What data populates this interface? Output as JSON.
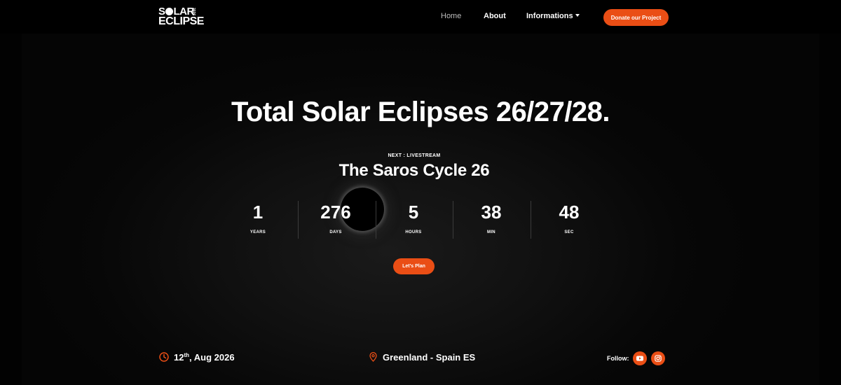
{
  "header": {
    "logo_line1_a": "S",
    "logo_line1_b": "LAR",
    "logo_tiny": "2026",
    "logo_line2": "ECLIPSE",
    "nav": {
      "home": "Home",
      "about": "About",
      "informations": "Informations"
    },
    "donate_label": "Donate our Project"
  },
  "hero": {
    "title": "Total Solar Eclipses 26/27/28.",
    "next_label": "NEXT : LIVESTREAM",
    "subtitle": "The Saros Cycle 26",
    "countdown": [
      {
        "value": "1",
        "unit": "YEARS"
      },
      {
        "value": "276",
        "unit": "DAYS"
      },
      {
        "value": "5",
        "unit": "HOURS"
      },
      {
        "value": "38",
        "unit": "MIN"
      },
      {
        "value": "48",
        "unit": "SEC"
      }
    ],
    "plan_label": "Let's Plan"
  },
  "footer": {
    "date_day": "12",
    "date_suffix": "th",
    "date_rest": ", Aug 2026",
    "location": "Greenland - Spain ES",
    "follow_label": "Follow:"
  },
  "colors": {
    "accent": "#ea4e15",
    "background": "#000000"
  },
  "icons": {
    "clock": "clock-icon",
    "pin": "map-pin-icon",
    "youtube": "youtube-icon",
    "instagram": "instagram-icon"
  }
}
